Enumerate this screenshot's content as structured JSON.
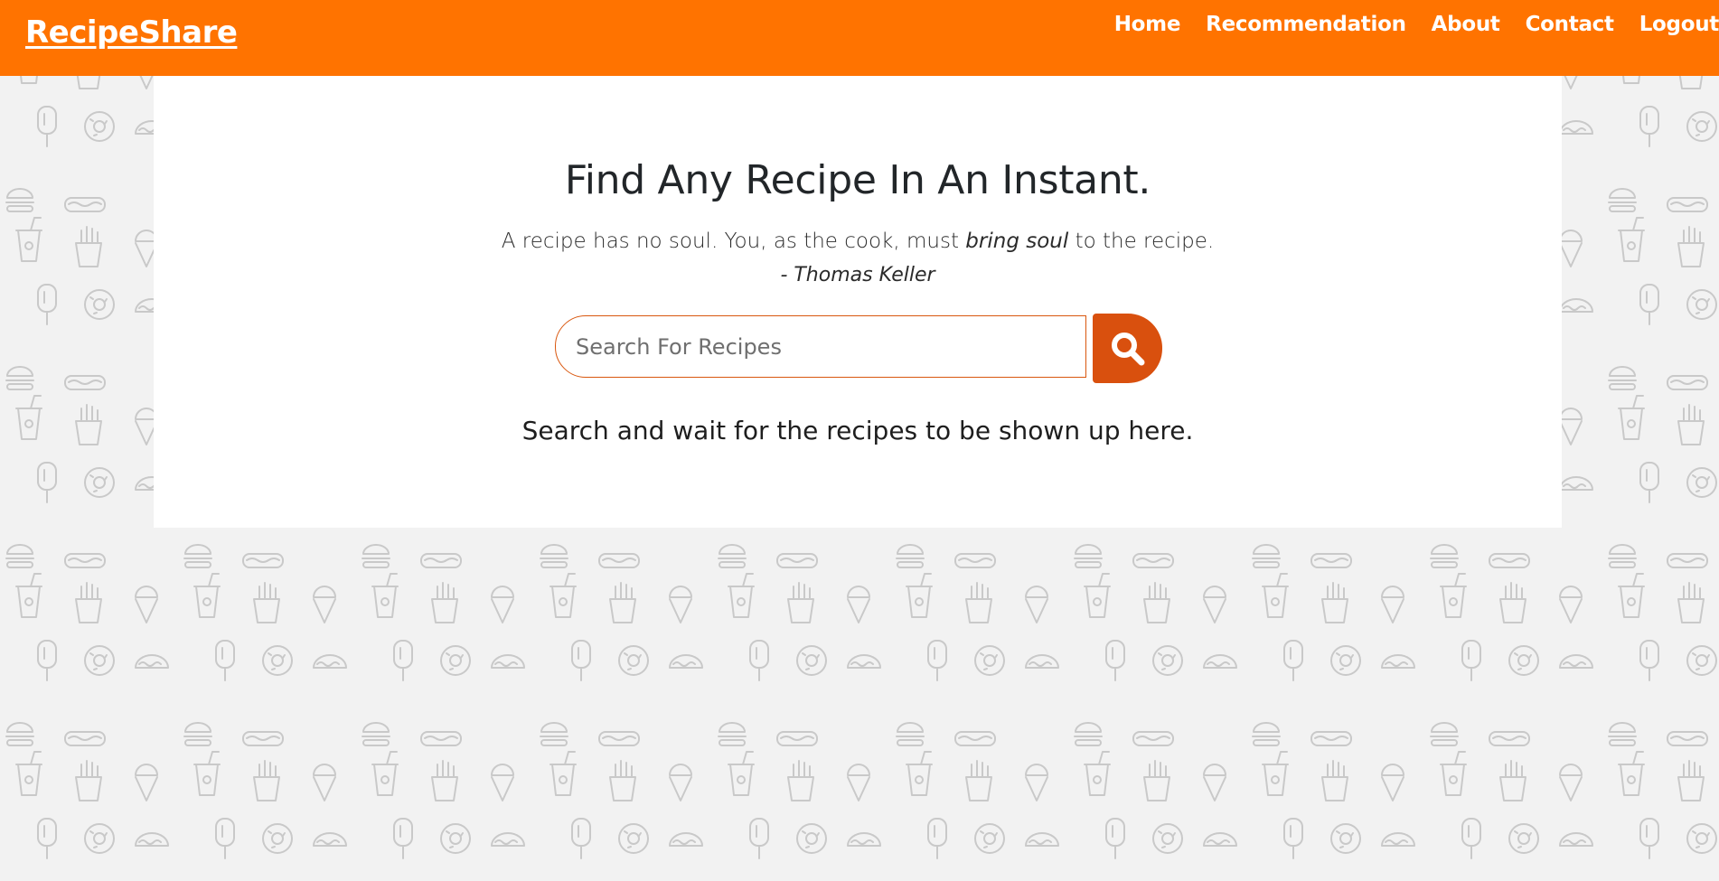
{
  "brand": {
    "name": "RecipeShare"
  },
  "nav": {
    "items": [
      {
        "label": "Home"
      },
      {
        "label": "Recommendation"
      },
      {
        "label": "About"
      },
      {
        "label": "Contact"
      },
      {
        "label": "Logout"
      }
    ]
  },
  "hero": {
    "title": "Find Any Recipe In An Instant.",
    "quote_part1": "A recipe has no soul. You, as the cook, must ",
    "quote_emphasis": "bring soul",
    "quote_part2": " to the recipe.",
    "author": "- Thomas Keller"
  },
  "search": {
    "placeholder": "Search For Recipes",
    "value": "",
    "button_icon": "magnifier-icon"
  },
  "results": {
    "message": "Search and wait for the recipes to be shown up here."
  },
  "colors": {
    "navbar": "#ff7300",
    "accent": "#d9500e",
    "background": "#f2f2f2",
    "card": "#ffffff",
    "pattern_stroke": "#c9c9c9"
  },
  "background_pattern": {
    "icons": [
      "burger-icon",
      "hotdog-icon",
      "drink-cup-icon",
      "fries-icon",
      "ice-cream-cone-icon",
      "popsicle-icon",
      "donut-icon",
      "taco-icon"
    ]
  }
}
